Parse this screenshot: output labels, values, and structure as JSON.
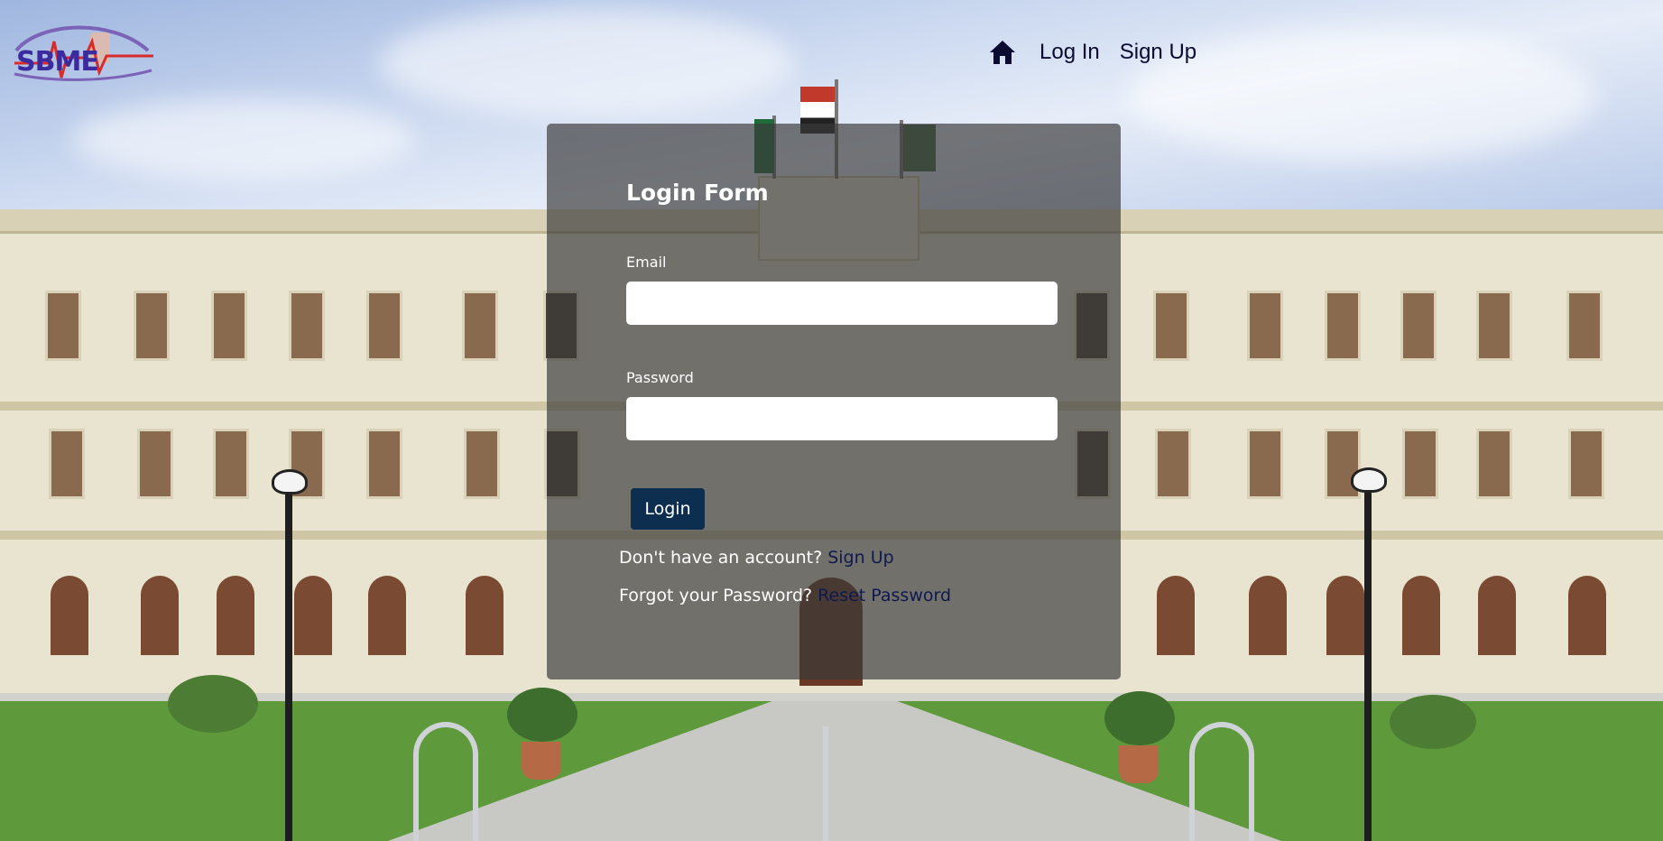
{
  "brand": {
    "logo_alt": "SBME"
  },
  "nav": {
    "home_icon": "home-icon",
    "login_label": "Log In",
    "signup_label": "Sign Up"
  },
  "form": {
    "title": "Login Form",
    "email_label": "Email",
    "email_value": "",
    "password_label": "Password",
    "password_value": "",
    "submit_label": "Login",
    "no_account_text": "Don't have an account?",
    "signup_link": "Sign Up",
    "forgot_text": "Forgot your Password?",
    "reset_link": "Reset Password"
  },
  "colors": {
    "nav_text": "#0b0b32",
    "panel_overlay": "rgba(58,58,58,0.68)",
    "button_bg": "#0d2e4e",
    "link_color": "#0e1a4e"
  }
}
